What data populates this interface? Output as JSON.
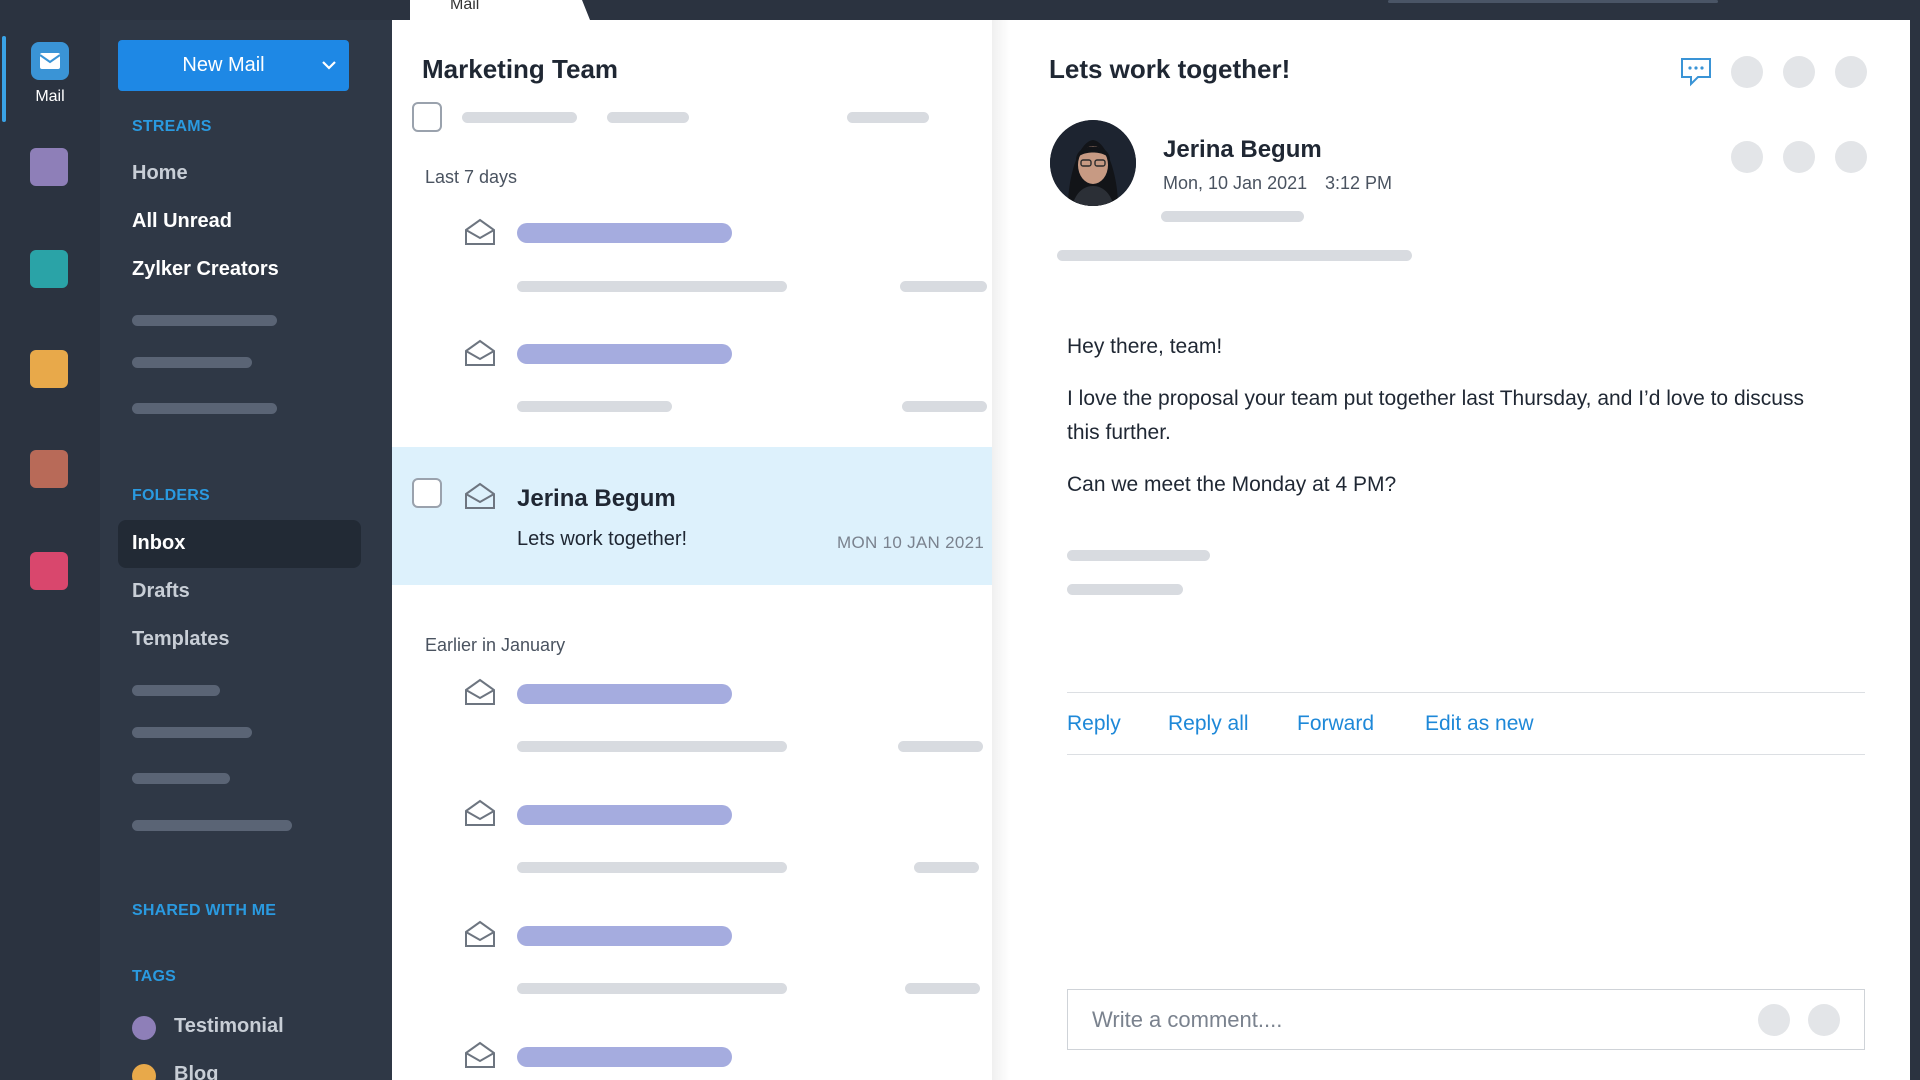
{
  "topbar": {
    "active_tab": "Mail"
  },
  "rail": {
    "mail_label": "Mail",
    "app_colors": [
      "#8e7fb8",
      "#2aa3a7",
      "#e8a94a",
      "#b86a58",
      "#d9476d"
    ]
  },
  "sidebar": {
    "new_mail_label": "New Mail",
    "streams_title": "STREAMS",
    "streams": [
      {
        "label": "Home"
      },
      {
        "label": "All Unread"
      },
      {
        "label": "Zylker Creators"
      }
    ],
    "folders_title": "FOLDERS",
    "folders": [
      {
        "label": "Inbox"
      },
      {
        "label": "Drafts"
      },
      {
        "label": "Templates"
      }
    ],
    "shared_title": "SHARED WITH ME",
    "tags_title": "TAGS",
    "tags": [
      {
        "label": "Testimonial",
        "color": "#8e7fb8"
      },
      {
        "label": "Blog",
        "color": "#e8a94a"
      }
    ]
  },
  "list": {
    "title": "Marketing Team",
    "group_recent": "Last 7 days",
    "group_earlier": "Earlier in January",
    "selected": {
      "sender": "Jerina Begum",
      "subject": "Lets work together!",
      "date": "MON 10 JAN 2021"
    }
  },
  "reader": {
    "subject": "Lets work together!",
    "sender": "Jerina Begum",
    "date": "Mon,  10 Jan 2021",
    "time": "3:12 PM",
    "body": [
      "Hey there, team!",
      "I love the proposal your team put together last Thursday, and I’d love to discuss this further.",
      "Can we meet the Monday at 4 PM?"
    ],
    "actions": {
      "reply": "Reply",
      "reply_all": "Reply all",
      "forward": "Forward",
      "edit_as_new": "Edit as new"
    },
    "comment_placeholder": "Write a comment...."
  },
  "colors": {
    "accent": "#1e88e5",
    "section_title": "#2a9ae0",
    "selected_row": "#ddf1fc",
    "skeleton_blue": "#a5acdf"
  }
}
